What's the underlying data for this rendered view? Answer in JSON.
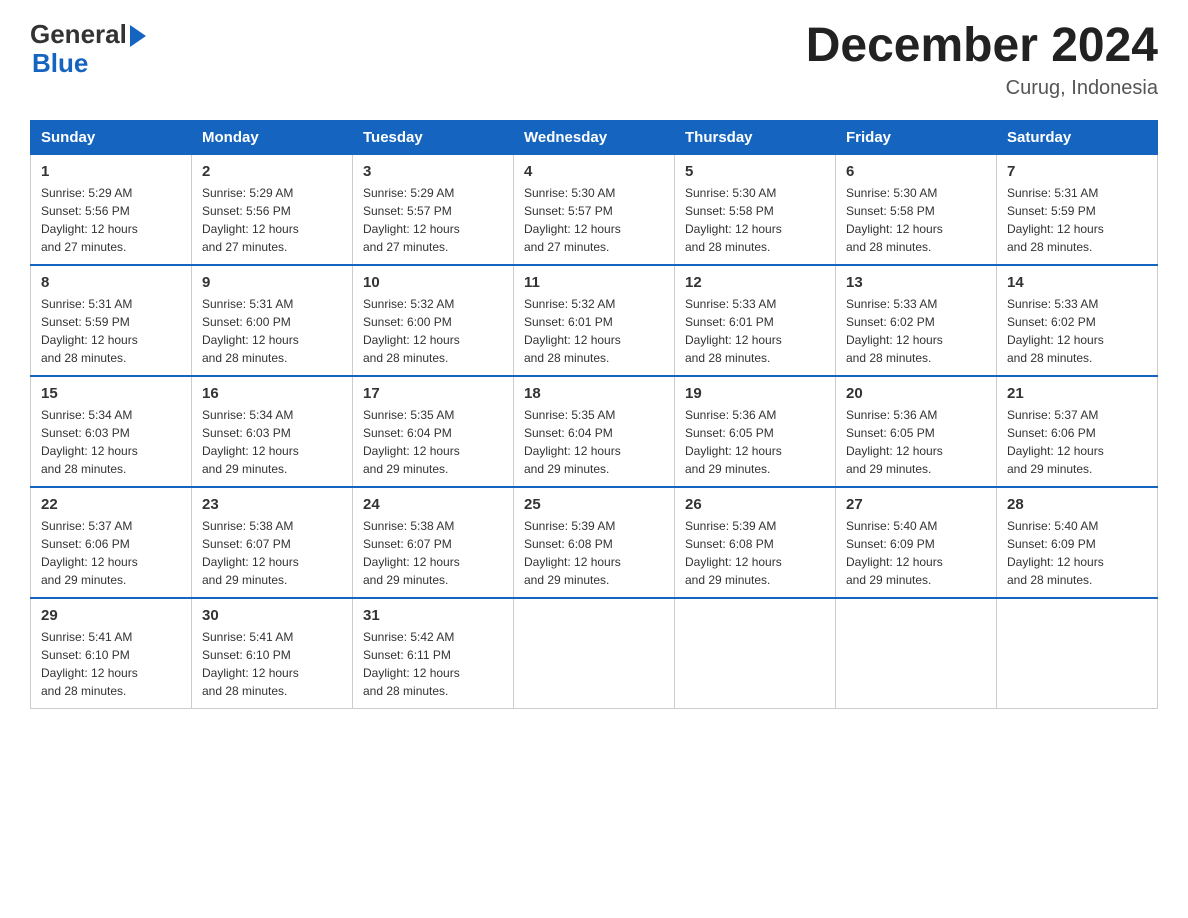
{
  "header": {
    "logo_text_general": "General",
    "logo_text_blue": "Blue",
    "month_title": "December 2024",
    "location": "Curug, Indonesia"
  },
  "days_of_week": [
    "Sunday",
    "Monday",
    "Tuesday",
    "Wednesday",
    "Thursday",
    "Friday",
    "Saturday"
  ],
  "weeks": [
    [
      {
        "day": "1",
        "sunrise": "5:29 AM",
        "sunset": "5:56 PM",
        "daylight": "12 hours and 27 minutes."
      },
      {
        "day": "2",
        "sunrise": "5:29 AM",
        "sunset": "5:56 PM",
        "daylight": "12 hours and 27 minutes."
      },
      {
        "day": "3",
        "sunrise": "5:29 AM",
        "sunset": "5:57 PM",
        "daylight": "12 hours and 27 minutes."
      },
      {
        "day": "4",
        "sunrise": "5:30 AM",
        "sunset": "5:57 PM",
        "daylight": "12 hours and 27 minutes."
      },
      {
        "day": "5",
        "sunrise": "5:30 AM",
        "sunset": "5:58 PM",
        "daylight": "12 hours and 28 minutes."
      },
      {
        "day": "6",
        "sunrise": "5:30 AM",
        "sunset": "5:58 PM",
        "daylight": "12 hours and 28 minutes."
      },
      {
        "day": "7",
        "sunrise": "5:31 AM",
        "sunset": "5:59 PM",
        "daylight": "12 hours and 28 minutes."
      }
    ],
    [
      {
        "day": "8",
        "sunrise": "5:31 AM",
        "sunset": "5:59 PM",
        "daylight": "12 hours and 28 minutes."
      },
      {
        "day": "9",
        "sunrise": "5:31 AM",
        "sunset": "6:00 PM",
        "daylight": "12 hours and 28 minutes."
      },
      {
        "day": "10",
        "sunrise": "5:32 AM",
        "sunset": "6:00 PM",
        "daylight": "12 hours and 28 minutes."
      },
      {
        "day": "11",
        "sunrise": "5:32 AM",
        "sunset": "6:01 PM",
        "daylight": "12 hours and 28 minutes."
      },
      {
        "day": "12",
        "sunrise": "5:33 AM",
        "sunset": "6:01 PM",
        "daylight": "12 hours and 28 minutes."
      },
      {
        "day": "13",
        "sunrise": "5:33 AM",
        "sunset": "6:02 PM",
        "daylight": "12 hours and 28 minutes."
      },
      {
        "day": "14",
        "sunrise": "5:33 AM",
        "sunset": "6:02 PM",
        "daylight": "12 hours and 28 minutes."
      }
    ],
    [
      {
        "day": "15",
        "sunrise": "5:34 AM",
        "sunset": "6:03 PM",
        "daylight": "12 hours and 28 minutes."
      },
      {
        "day": "16",
        "sunrise": "5:34 AM",
        "sunset": "6:03 PM",
        "daylight": "12 hours and 29 minutes."
      },
      {
        "day": "17",
        "sunrise": "5:35 AM",
        "sunset": "6:04 PM",
        "daylight": "12 hours and 29 minutes."
      },
      {
        "day": "18",
        "sunrise": "5:35 AM",
        "sunset": "6:04 PM",
        "daylight": "12 hours and 29 minutes."
      },
      {
        "day": "19",
        "sunrise": "5:36 AM",
        "sunset": "6:05 PM",
        "daylight": "12 hours and 29 minutes."
      },
      {
        "day": "20",
        "sunrise": "5:36 AM",
        "sunset": "6:05 PM",
        "daylight": "12 hours and 29 minutes."
      },
      {
        "day": "21",
        "sunrise": "5:37 AM",
        "sunset": "6:06 PM",
        "daylight": "12 hours and 29 minutes."
      }
    ],
    [
      {
        "day": "22",
        "sunrise": "5:37 AM",
        "sunset": "6:06 PM",
        "daylight": "12 hours and 29 minutes."
      },
      {
        "day": "23",
        "sunrise": "5:38 AM",
        "sunset": "6:07 PM",
        "daylight": "12 hours and 29 minutes."
      },
      {
        "day": "24",
        "sunrise": "5:38 AM",
        "sunset": "6:07 PM",
        "daylight": "12 hours and 29 minutes."
      },
      {
        "day": "25",
        "sunrise": "5:39 AM",
        "sunset": "6:08 PM",
        "daylight": "12 hours and 29 minutes."
      },
      {
        "day": "26",
        "sunrise": "5:39 AM",
        "sunset": "6:08 PM",
        "daylight": "12 hours and 29 minutes."
      },
      {
        "day": "27",
        "sunrise": "5:40 AM",
        "sunset": "6:09 PM",
        "daylight": "12 hours and 29 minutes."
      },
      {
        "day": "28",
        "sunrise": "5:40 AM",
        "sunset": "6:09 PM",
        "daylight": "12 hours and 28 minutes."
      }
    ],
    [
      {
        "day": "29",
        "sunrise": "5:41 AM",
        "sunset": "6:10 PM",
        "daylight": "12 hours and 28 minutes."
      },
      {
        "day": "30",
        "sunrise": "5:41 AM",
        "sunset": "6:10 PM",
        "daylight": "12 hours and 28 minutes."
      },
      {
        "day": "31",
        "sunrise": "5:42 AM",
        "sunset": "6:11 PM",
        "daylight": "12 hours and 28 minutes."
      },
      null,
      null,
      null,
      null
    ]
  ],
  "labels": {
    "sunrise": "Sunrise:",
    "sunset": "Sunset:",
    "daylight": "Daylight:"
  }
}
